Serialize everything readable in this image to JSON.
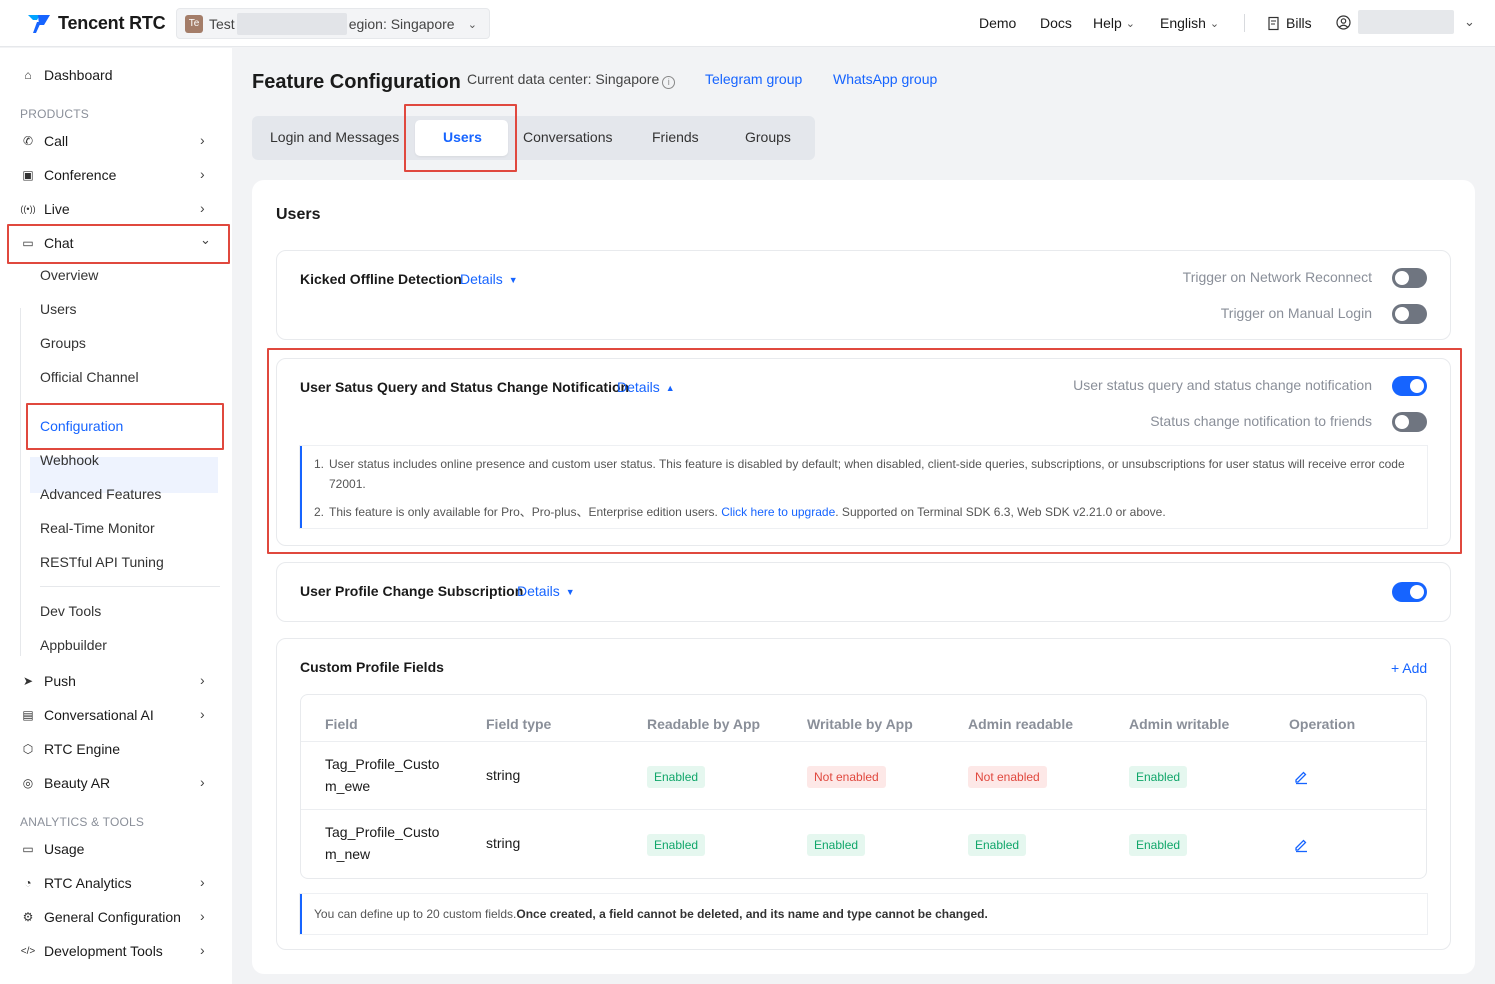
{
  "brand": {
    "name": "Tencent RTC",
    "color": "#1664ff"
  },
  "app_selector": {
    "badge": "Te",
    "name": "Test",
    "region": "egion: Singapore"
  },
  "topnav": {
    "demo": "Demo",
    "docs": "Docs",
    "help": "Help",
    "language": "English",
    "bills": "Bills"
  },
  "sidebar": {
    "dashboard": "Dashboard",
    "products_heading": "PRODUCTS",
    "call": "Call",
    "conference": "Conference",
    "live": "Live",
    "chat": "Chat",
    "chat_sub": {
      "overview": "Overview",
      "users": "Users",
      "groups": "Groups",
      "official_channel": "Official Channel",
      "configuration": "Configuration",
      "webhook": "Webhook",
      "advanced_features": "Advanced Features",
      "realtime_monitor": "Real-Time Monitor",
      "restful_api_tuning": "RESTful API Tuning",
      "dev_tools": "Dev Tools",
      "appbuilder": "Appbuilder"
    },
    "push": "Push",
    "conversational_ai": "Conversational AI",
    "rtc_engine": "RTC Engine",
    "beauty_ar": "Beauty AR",
    "analytics_heading": "ANALYTICS & TOOLS",
    "usage": "Usage",
    "rtc_analytics": "RTC Analytics",
    "general_configuration": "General Configuration",
    "development_tools": "Development Tools"
  },
  "header": {
    "title": "Feature Configuration",
    "data_center": "Current data center: Singapore",
    "telegram": "Telegram group",
    "whatsapp": "WhatsApp group"
  },
  "tabs": {
    "login": "Login and Messages",
    "users": "Users",
    "conversations": "Conversations",
    "friends": "Friends",
    "groups": "Groups"
  },
  "content": {
    "section_title": "Users",
    "details": "Details",
    "kicked": {
      "title": "Kicked Offline Detection",
      "opt1": "Trigger on Network Reconnect",
      "opt1_on": false,
      "opt2": "Trigger on Manual Login",
      "opt2_on": false
    },
    "status": {
      "title": "User Satus Query and Status Change Notification",
      "opt1": "User status query and status change notification",
      "opt1_on": true,
      "opt2": "Status change notification to friends",
      "opt2_on": false,
      "note1_num": "1.",
      "note1": "User status includes online presence and custom user status. This feature is disabled by default; when disabled, client-side queries, subscriptions, or unsubscriptions for user status will receive error code 72001.",
      "note2_num": "2.",
      "note2_pre": "This feature is only available for Pro、Pro-plus、Enterprise edition users. ",
      "note2_link": "Click here to upgrade",
      "note2_post": ". Supported on Terminal SDK 6.3, Web SDK v2.21.0 or above."
    },
    "profile_sub": {
      "title": "User Profile Change Subscription",
      "on": true
    },
    "custom_fields": {
      "title": "Custom Profile Fields",
      "add": "+ Add",
      "columns": [
        "Field",
        "Field type",
        "Readable by App",
        "Writable by App",
        "Admin readable",
        "Admin writable",
        "Operation"
      ],
      "rows": [
        {
          "field_l1": "Tag_Profile_Custo",
          "field_l2": "m_ewe",
          "type": "string",
          "readable": "Enabled",
          "writable": "Not enabled",
          "admin_read": "Not enabled",
          "admin_write": "Enabled"
        },
        {
          "field_l1": "Tag_Profile_Custo",
          "field_l2": "m_new",
          "type": "string",
          "readable": "Enabled",
          "writable": "Enabled",
          "admin_read": "Enabled",
          "admin_write": "Enabled"
        }
      ],
      "note_plain": "You can define up to 20 custom fields.",
      "note_bold": "Once created, a field cannot be deleted, and its name and type cannot be changed."
    }
  }
}
